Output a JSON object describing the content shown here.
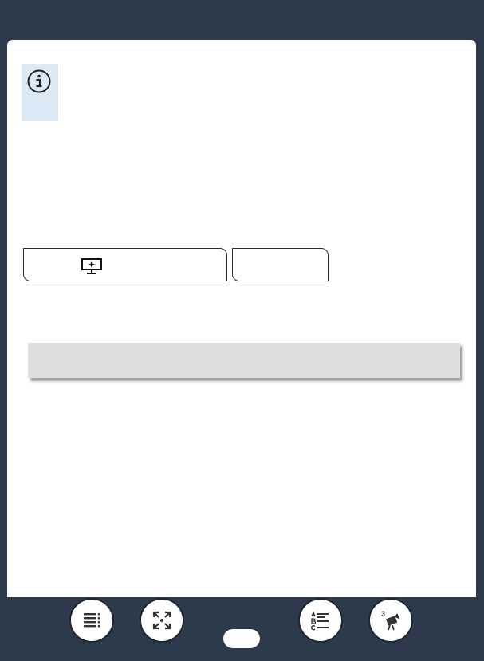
{
  "page": {
    "background": "#2c3a4b",
    "sheet": "#ffffff"
  },
  "info_note": {
    "icon": "info-icon",
    "background": "#dbe9f5"
  },
  "mode_bar": {
    "icon": "mode-icon"
  },
  "nav": {
    "buttons": [
      {
        "icon": "contents-icon"
      },
      {
        "icon": "fullscreen-icon"
      },
      {
        "icon": "index-icon"
      },
      {
        "icon": "camera-mode-icon",
        "badge": "3"
      }
    ],
    "page_indicator": ""
  }
}
